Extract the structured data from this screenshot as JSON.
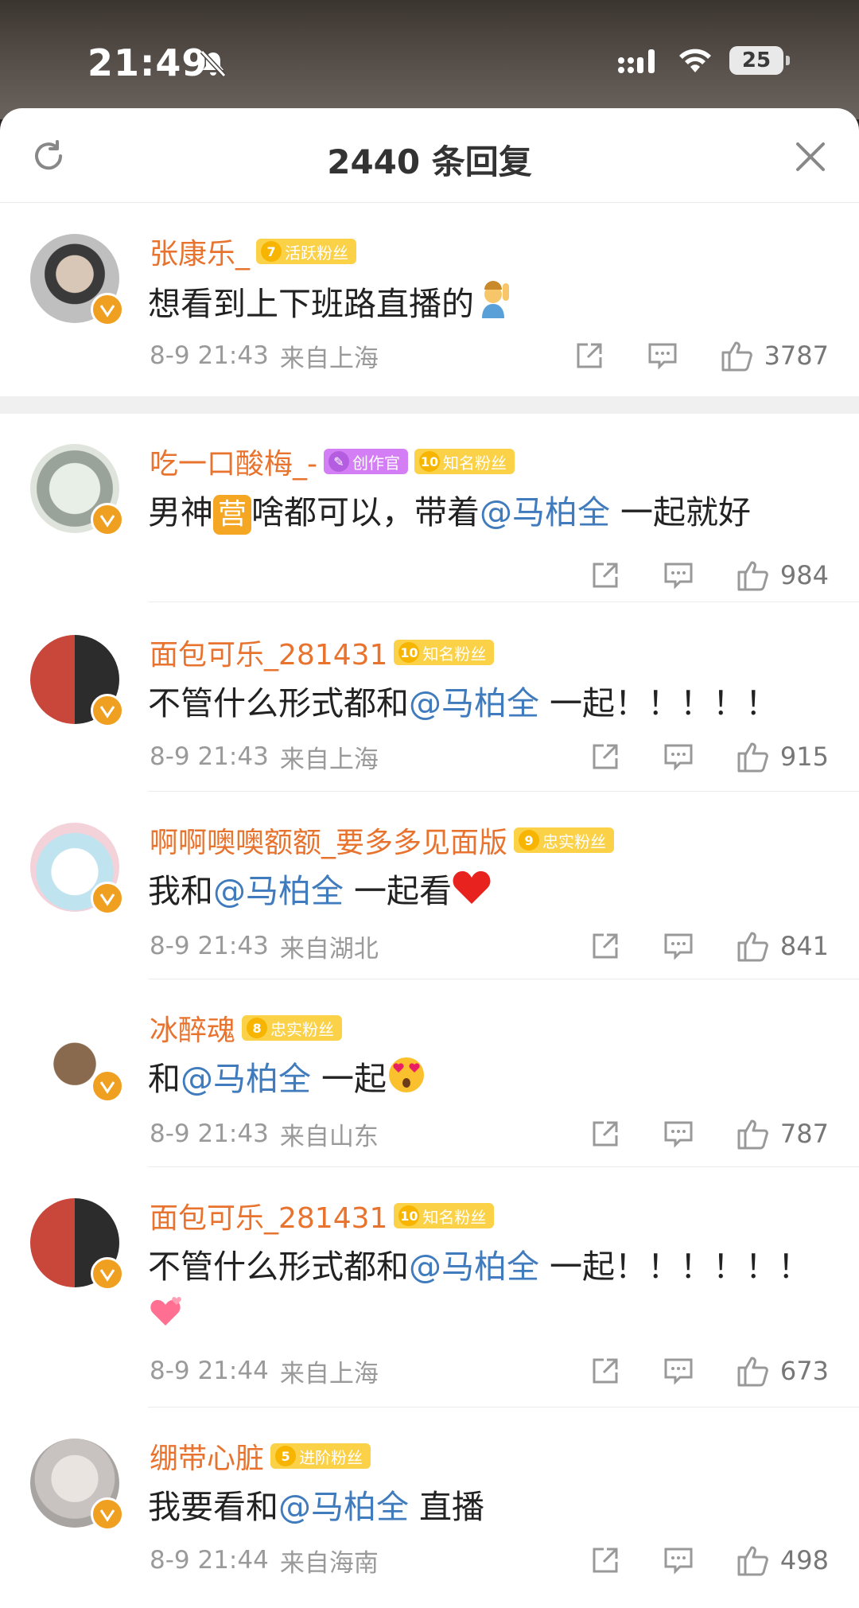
{
  "status_bar": {
    "time": "21:49",
    "battery": "25"
  },
  "header": {
    "title": "2440 条回复"
  },
  "colors": {
    "username": "#e8732e",
    "mention": "#3f7bbd",
    "tag_gold": "#fbd147",
    "tag_creator": "#d37ef5",
    "meta_gray": "#9a9a9a"
  },
  "comments": [
    {
      "username": "张康乐_",
      "tags": [
        {
          "level": "7",
          "label": "活跃粉丝"
        }
      ],
      "text_before": "想看到上下班路直播的",
      "mention": "",
      "text_after": "",
      "emoji": "person-raising-hand-emoji",
      "time": "8-9 21:43",
      "location": "来自上海",
      "likes": "3787"
    },
    {
      "username": "吃一口酸梅_-",
      "tags": [
        {
          "level": "✎",
          "label": "创作官"
        },
        {
          "level": "10",
          "label": "知名粉丝"
        }
      ],
      "text_before": "男神",
      "badge": "营",
      "text_mid": "啥都可以，带着",
      "mention": "@马柏全",
      "text_after": " 一起就好",
      "time": "",
      "location": "",
      "likes": "984"
    },
    {
      "username": "面包可乐_281431",
      "tags": [
        {
          "level": "10",
          "label": "知名粉丝"
        }
      ],
      "text_before": "不管什么形式都和",
      "mention": "@马柏全",
      "text_after": " 一起！！！！！",
      "time": "8-9 21:43",
      "location": "来自上海",
      "likes": "915"
    },
    {
      "username": "啊啊噢噢额额_要多多见面版",
      "tags": [
        {
          "level": "9",
          "label": "忠实粉丝"
        }
      ],
      "text_before": "我和",
      "mention": "@马柏全",
      "text_after": " 一起看",
      "emoji": "red-heart-emoji",
      "time": "8-9 21:43",
      "location": "来自湖北",
      "likes": "841"
    },
    {
      "username": "冰醉魂",
      "tags": [
        {
          "level": "8",
          "label": "忠实粉丝"
        }
      ],
      "text_before": "和",
      "mention": "@马柏全",
      "text_after": " 一起",
      "emoji": "heart-eyes-emoji",
      "time": "8-9 21:43",
      "location": "来自山东",
      "likes": "787"
    },
    {
      "username": "面包可乐_281431",
      "tags": [
        {
          "level": "10",
          "label": "知名粉丝"
        }
      ],
      "text_before": "不管什么形式都和",
      "mention": "@马柏全",
      "text_after": " 一起！！！！！！",
      "emoji": "hearts-emoji",
      "time": "8-9 21:44",
      "location": "来自上海",
      "likes": "673"
    },
    {
      "username": "绷带心脏",
      "tags": [
        {
          "level": "5",
          "label": "进阶粉丝"
        }
      ],
      "text_before": "我要看和",
      "mention": "@马柏全",
      "text_after": " 直播",
      "time": "8-9 21:44",
      "location": "来自海南",
      "likes": "498"
    }
  ]
}
